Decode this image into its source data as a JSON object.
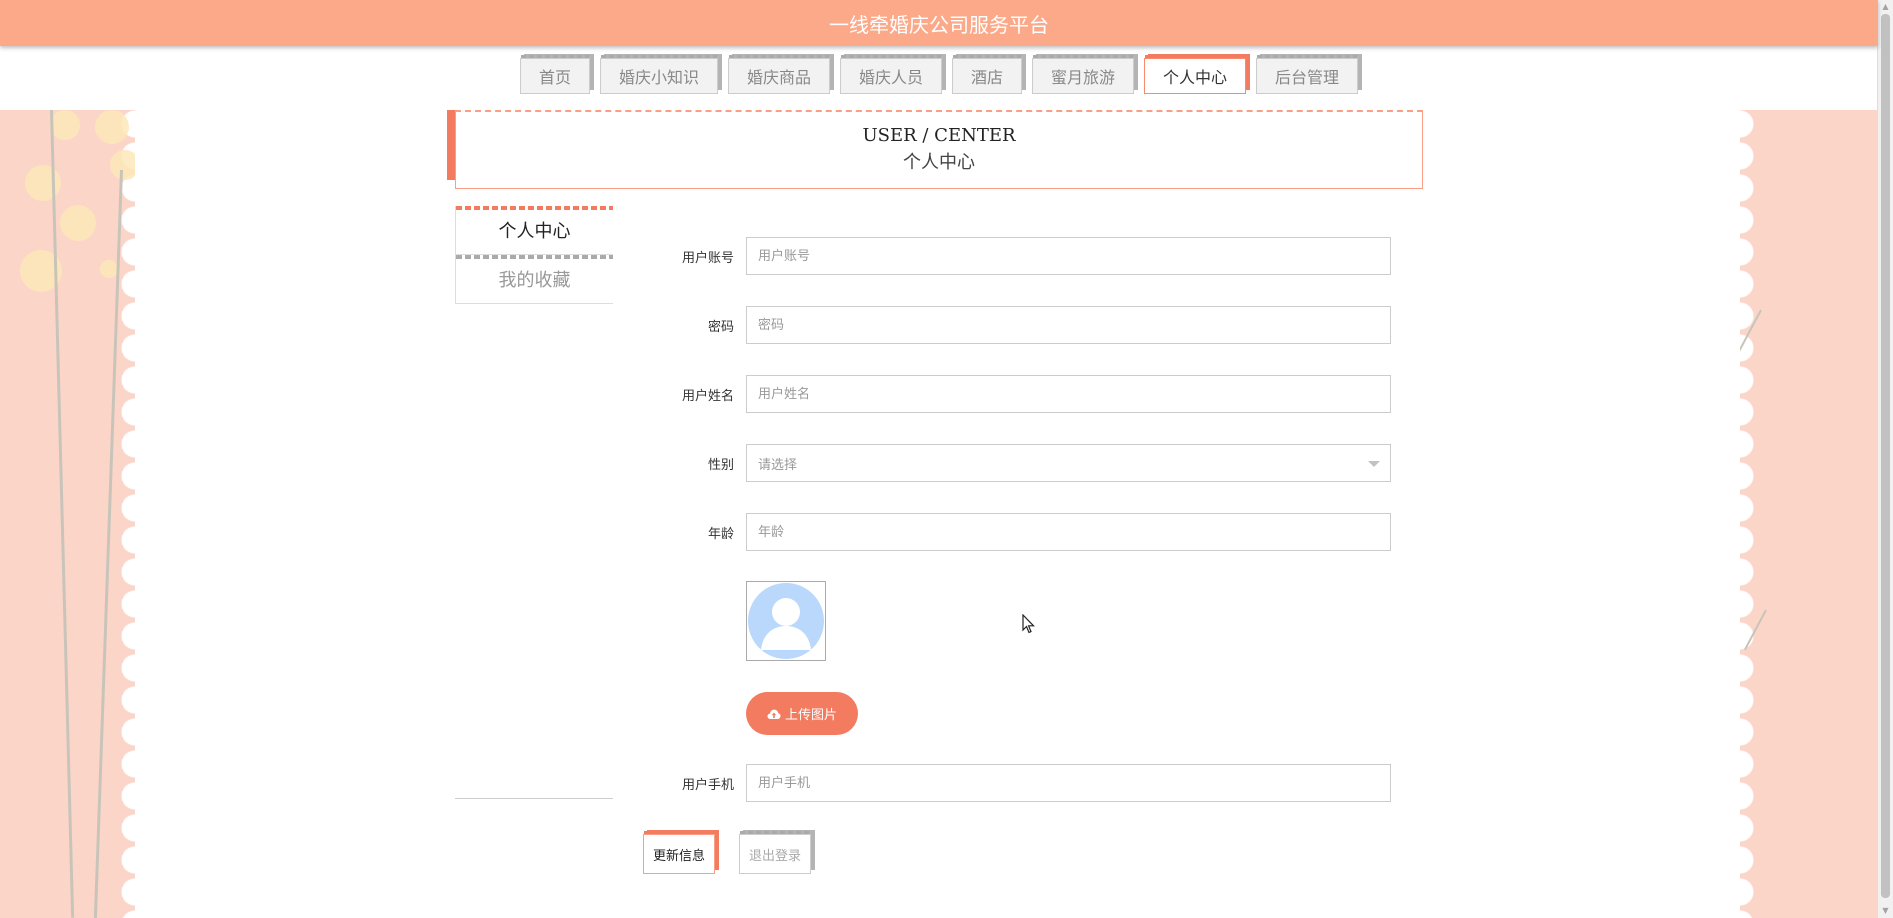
{
  "app": {
    "title": "一线牵婚庆公司服务平台"
  },
  "nav": {
    "items": [
      {
        "label": "首页",
        "active": false
      },
      {
        "label": "婚庆小知识",
        "active": false
      },
      {
        "label": "婚庆商品",
        "active": false
      },
      {
        "label": "婚庆人员",
        "active": false
      },
      {
        "label": "酒店",
        "active": false
      },
      {
        "label": "蜜月旅游",
        "active": false
      },
      {
        "label": "个人中心",
        "active": true
      },
      {
        "label": "后台管理",
        "active": false
      }
    ]
  },
  "header": {
    "en": "USER / CENTER",
    "cn": "个人中心"
  },
  "menu": {
    "items": [
      {
        "label": "个人中心",
        "active": true
      },
      {
        "label": "我的收藏",
        "active": false
      }
    ]
  },
  "form": {
    "account": {
      "label": "用户账号",
      "placeholder": "用户账号",
      "value": ""
    },
    "password": {
      "label": "密码",
      "placeholder": "密码",
      "value": ""
    },
    "name": {
      "label": "用户姓名",
      "placeholder": "用户姓名",
      "value": ""
    },
    "gender": {
      "label": "性别",
      "selected": "请选择"
    },
    "age": {
      "label": "年龄",
      "placeholder": "年龄",
      "value": ""
    },
    "upload_label": "上传图片",
    "phone": {
      "label": "用户手机",
      "placeholder": "用户手机",
      "value": ""
    }
  },
  "actions": {
    "update": "更新信息",
    "logout": "退出登录"
  },
  "colors": {
    "accent": "#f37b5f",
    "topbar": "#fba989",
    "side": "#fcd5c9"
  },
  "icons": {
    "upload": "cloud-upload-icon",
    "avatar": "user-avatar-icon",
    "caret": "chevron-down-icon"
  }
}
